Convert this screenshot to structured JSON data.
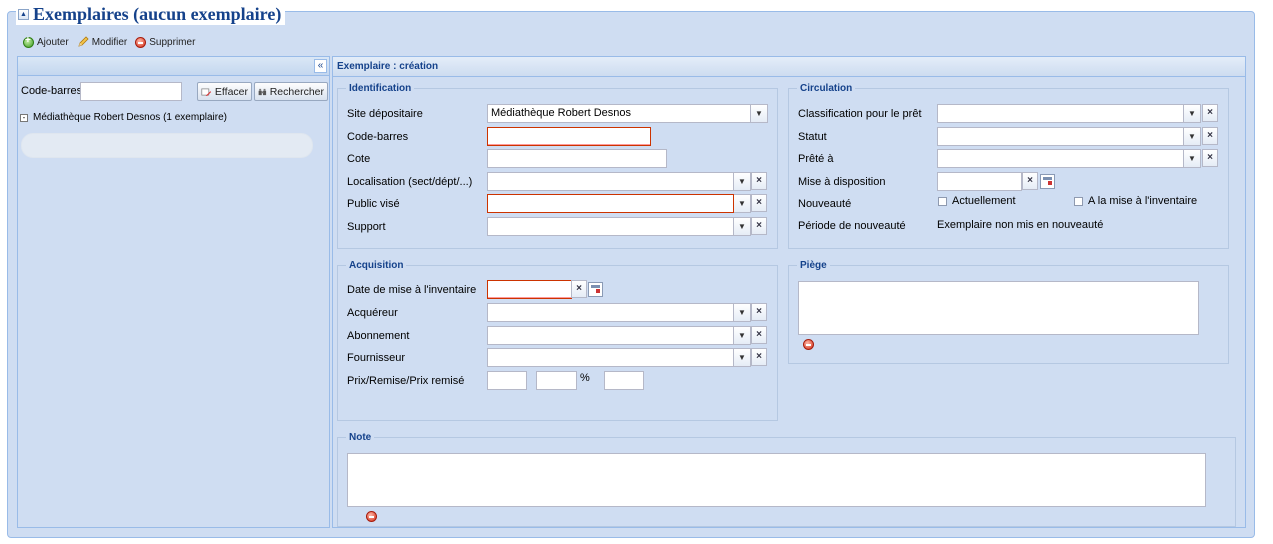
{
  "header": {
    "title": "Exemplaires (aucun exemplaire)"
  },
  "toolbar": {
    "add_label": "Ajouter",
    "edit_label": "Modifier",
    "delete_label": "Supprimer"
  },
  "left": {
    "barcode_label": "Code-barres",
    "barcode_value": "",
    "clear_label": "Effacer",
    "search_label": "Rechercher",
    "tree_item": "Médiathèque Robert Desnos (1 exemplaire)"
  },
  "panel": {
    "title": "Exemplaire : création"
  },
  "identification": {
    "legend": "Identification",
    "site_label": "Site dépositaire",
    "site_value": "Médiathèque Robert Desnos",
    "barcode_label": "Code-barres",
    "cote_label": "Cote",
    "location_label": "Localisation (sect/dépt/...)",
    "public_label": "Public visé",
    "support_label": "Support"
  },
  "circulation": {
    "legend": "Circulation",
    "classification_label": "Classification pour le prêt",
    "status_label": "Statut",
    "lent_label": "Prêté à",
    "disposal_label": "Mise à disposition",
    "novelty_label": "Nouveauté",
    "currently_label": "Actuellement",
    "inventory_label": "A la mise à l'inventaire",
    "novelty_period_label": "Période de nouveauté",
    "novelty_period_value": "Exemplaire non mis en nouveauté"
  },
  "acquisition": {
    "legend": "Acquisition",
    "inventory_date_label": "Date de mise à l'inventaire",
    "buyer_label": "Acquéreur",
    "subscription_label": "Abonnement",
    "supplier_label": "Fournisseur",
    "price_label": "Prix/Remise/Prix remisé",
    "percent": "%"
  },
  "trap": {
    "legend": "Piège"
  },
  "note": {
    "legend": "Note"
  },
  "colors": {
    "header": "#15428b",
    "panel_bg": "#cfddf2",
    "border": "#99bbe8",
    "error": "#cc3300"
  }
}
